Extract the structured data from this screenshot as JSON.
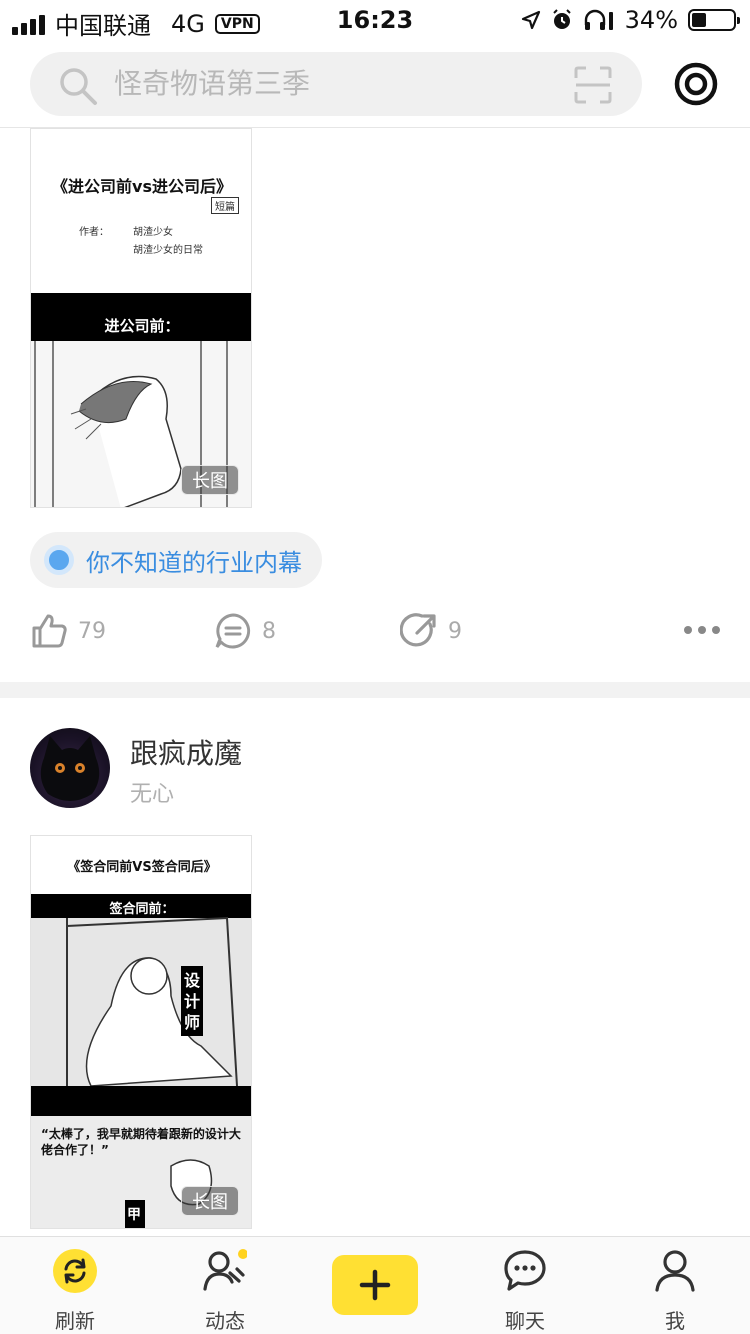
{
  "status_bar": {
    "carrier": "中国联通",
    "network": "4G",
    "vpn": "VPN",
    "time": "16:23",
    "battery": "34%",
    "battery_level": 0.34
  },
  "header": {
    "search_placeholder": "怪奇物语第三季"
  },
  "post1": {
    "image": {
      "title": "《进公司前vs进公司后》",
      "tag": "短篇",
      "author_line1": "作者：",
      "author_name": "胡渣少女",
      "author_weibo": "胡渣少女的日常",
      "banner": "进公司前：",
      "badge": "长图"
    },
    "topic": "你不知道的行业内幕",
    "likes": "79",
    "comments": "8",
    "shares": "9"
  },
  "post2": {
    "author": "跟疯成魔",
    "subtitle": "无心",
    "image": {
      "title": "《签合同前VS签合同后》",
      "banner": "签合同前：",
      "vertical_label": "设计师",
      "quote": "“太棒了，我早就期待着跟新的设计大佬合作了！”",
      "speaker": "甲",
      "badge": "长图"
    }
  },
  "tabs": [
    {
      "label": "刷新",
      "icon": "refresh-icon"
    },
    {
      "label": "动态",
      "icon": "contacts-icon"
    },
    {
      "label": "",
      "icon": "plus-icon"
    },
    {
      "label": "聊天",
      "icon": "chat-icon"
    },
    {
      "label": "我",
      "icon": "profile-icon"
    }
  ],
  "colors": {
    "accent_yellow": "#ffe033",
    "topic_blue": "#3a8de0"
  }
}
